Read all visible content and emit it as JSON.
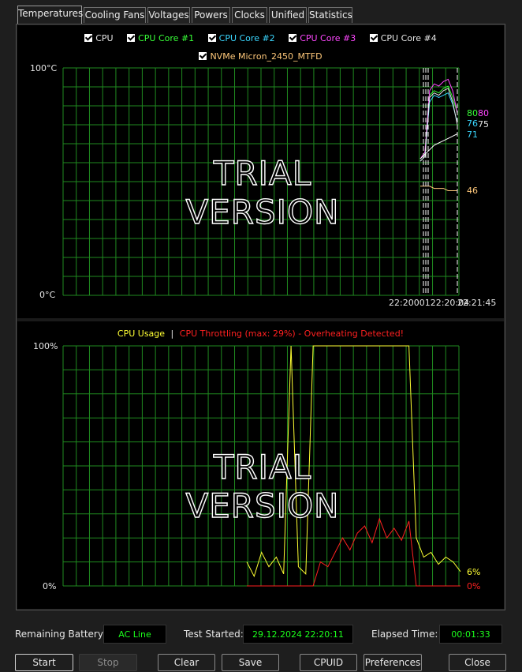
{
  "tabs": [
    {
      "label": "Temperatures",
      "active": true
    },
    {
      "label": "Cooling Fans",
      "active": false
    },
    {
      "label": "Voltages",
      "active": false
    },
    {
      "label": "Powers",
      "active": false
    },
    {
      "label": "Clocks",
      "active": false
    },
    {
      "label": "Unified",
      "active": false
    },
    {
      "label": "Statistics",
      "active": false
    }
  ],
  "temp_chart": {
    "legend": [
      {
        "label": "CPU",
        "color": "#ffffff"
      },
      {
        "label": "CPU Core #1",
        "color": "#38ff38"
      },
      {
        "label": "CPU Core #2",
        "color": "#3ad7ff"
      },
      {
        "label": "CPU Core #3",
        "color": "#ff47ff"
      },
      {
        "label": "CPU Core #4",
        "color": "#e6e6e6"
      },
      {
        "label": "NVMe Micron_2450_MTFD",
        "color": "#ffc87a"
      }
    ],
    "y_max_label": "100°C",
    "y_min_label": "0°C",
    "watermark": "TRIAL VERSION",
    "x_labels_overlap": "22:2000122:20:04",
    "x_label_end": "22:21:45",
    "values": {
      "core1": "80",
      "core3": "80",
      "core2": "76",
      "core4": "75",
      "cpu": "71",
      "nvme": "46"
    }
  },
  "usage_chart": {
    "legend_usage": "CPU Usage",
    "legend_sep": "|",
    "legend_throttle": "CPU Throttling (max: 29%) - Overheating Detected!",
    "y_max_label": "100%",
    "y_min_label": "0%",
    "watermark": "TRIAL VERSION",
    "usage_value": "6%",
    "throttle_value": "0%"
  },
  "chart_data": [
    {
      "type": "line",
      "title": "",
      "ylim": [
        0,
        100
      ],
      "series": [
        {
          "name": "CPU Core #1",
          "color": "#38ff38",
          "values": [
            60,
            62,
            88,
            90,
            89,
            91,
            92,
            87,
            80
          ]
        },
        {
          "name": "CPU Core #2",
          "color": "#3ad7ff",
          "values": [
            59,
            61,
            85,
            88,
            87,
            88,
            89,
            84,
            76
          ]
        },
        {
          "name": "CPU Core #3",
          "color": "#ff47ff",
          "values": [
            60,
            63,
            90,
            93,
            92,
            94,
            95,
            90,
            80
          ]
        },
        {
          "name": "CPU Core #4",
          "color": "#e6e6e6",
          "values": [
            59,
            61,
            87,
            89,
            88,
            90,
            91,
            85,
            75
          ]
        },
        {
          "name": "CPU",
          "color": "#ffffff",
          "values": [
            60,
            62,
            64,
            66,
            67,
            68,
            69,
            70,
            71
          ]
        },
        {
          "name": "NVMe Micron_2450_MTFD",
          "color": "#ffc87a",
          "values": [
            48,
            48,
            48,
            47,
            47,
            47,
            46,
            46,
            46
          ]
        }
      ]
    },
    {
      "type": "line",
      "title": "",
      "ylim": [
        0,
        100
      ],
      "series": [
        {
          "name": "CPU Usage",
          "color": "#ffff33",
          "values": [
            10,
            4,
            14,
            8,
            12,
            5,
            100,
            8,
            5,
            100,
            100,
            100,
            100,
            100,
            100,
            100,
            100,
            100,
            100,
            100,
            100,
            100,
            100,
            20,
            12,
            14,
            9,
            12,
            10,
            6
          ]
        },
        {
          "name": "CPU Throttling",
          "color": "#ff2020",
          "values": [
            0,
            0,
            0,
            0,
            0,
            0,
            0,
            0,
            0,
            0,
            10,
            8,
            14,
            20,
            15,
            22,
            25,
            18,
            28,
            20,
            24,
            19,
            27,
            0,
            0,
            0,
            0,
            0,
            0,
            0
          ]
        }
      ]
    }
  ],
  "status": {
    "battery_label": "Remaining Battery:",
    "battery_value": "AC Line",
    "started_label": "Test Started:",
    "started_value": "29.12.2024 22:20:11",
    "elapsed_label": "Elapsed Time:",
    "elapsed_value": "00:01:33"
  },
  "buttons": {
    "start": "Start",
    "stop": "Stop",
    "clear": "Clear",
    "save": "Save",
    "cpuid": "CPUID",
    "preferences": "Preferences",
    "close": "Close"
  }
}
